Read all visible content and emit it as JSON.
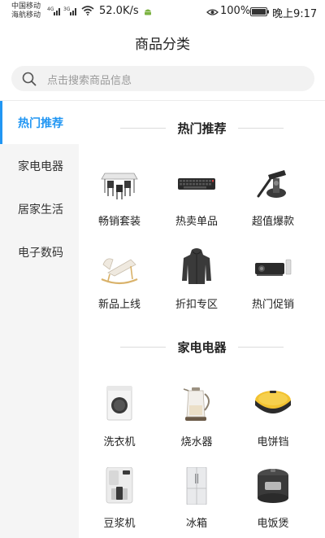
{
  "status_bar": {
    "carrier_line1": "中国移动",
    "carrier_line2": "海航移动",
    "net_speed": "52.0K/s",
    "battery": "100%",
    "time": "晚上9:17"
  },
  "header": {
    "title": "商品分类"
  },
  "search": {
    "placeholder": "点击搜索商品信息"
  },
  "sidebar": {
    "items": [
      {
        "label": "热门推荐",
        "active": true
      },
      {
        "label": "家电电器",
        "active": false
      },
      {
        "label": "居家生活",
        "active": false
      },
      {
        "label": "电子数码",
        "active": false
      }
    ]
  },
  "sections": [
    {
      "title": "热门推荐",
      "items": [
        {
          "label": "畅销套装",
          "icon": "dining-set-icon"
        },
        {
          "label": "热卖单品",
          "icon": "keyboard-icon"
        },
        {
          "label": "超值爆款",
          "icon": "car-mount-icon"
        },
        {
          "label": "新品上线",
          "icon": "rocking-chair-icon"
        },
        {
          "label": "折扣专区",
          "icon": "jacket-icon"
        },
        {
          "label": "热门促销",
          "icon": "projector-icon"
        }
      ]
    },
    {
      "title": "家电电器",
      "items": [
        {
          "label": "洗衣机",
          "icon": "washing-machine-icon"
        },
        {
          "label": "烧水器",
          "icon": "kettle-icon"
        },
        {
          "label": "电饼铛",
          "icon": "pancake-maker-icon"
        },
        {
          "label": "豆浆机",
          "icon": "soymilk-maker-icon"
        },
        {
          "label": "冰箱",
          "icon": "fridge-icon"
        },
        {
          "label": "电饭煲",
          "icon": "rice-cooker-icon"
        }
      ]
    }
  ]
}
